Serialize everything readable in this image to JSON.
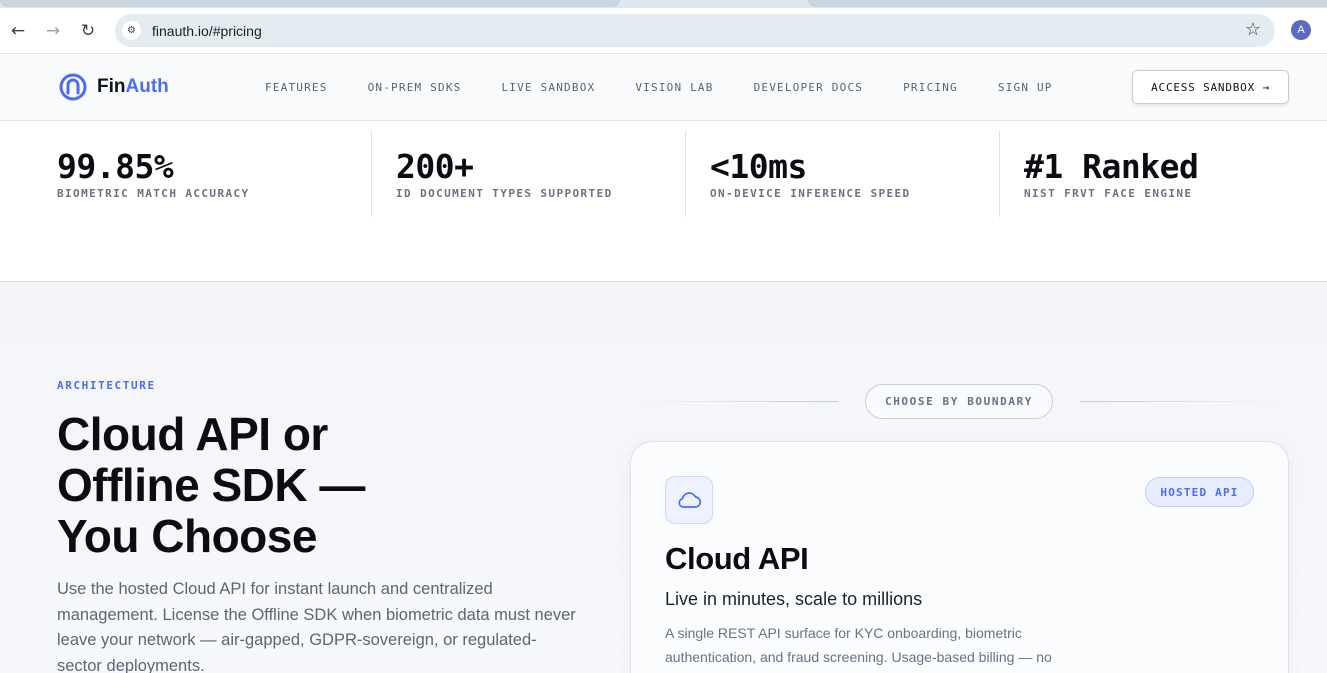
{
  "browser": {
    "url": "finauth.io/#pricing",
    "profile_initial": "A",
    "back_icon": "back-arrow-icon",
    "forward_icon": "forward-arrow-icon",
    "reload_icon": "reload-icon",
    "site_info_icon": "site-settings-icon",
    "bookmark_icon": "star-icon"
  },
  "header": {
    "logo_text_primary": "Fin",
    "logo_text_accent": "Auth",
    "nav": [
      {
        "label": "FEATURES"
      },
      {
        "label": "ON-PREM SDKS"
      },
      {
        "label": "LIVE SANDBOX"
      },
      {
        "label": "VISION LAB"
      },
      {
        "label": "DEVELOPER DOCS"
      },
      {
        "label": "PRICING"
      },
      {
        "label": "SIGN UP"
      }
    ],
    "cta_label": "ACCESS SANDBOX →"
  },
  "stats": [
    {
      "value": "99.85%",
      "label": "BIOMETRIC MATCH ACCURACY"
    },
    {
      "value": "200+",
      "label": "ID DOCUMENT TYPES SUPPORTED"
    },
    {
      "value": "<10ms",
      "label": "ON-DEVICE INFERENCE SPEED"
    },
    {
      "value": "#1 Ranked",
      "label": "NIST FRVT FACE ENGINE"
    }
  ],
  "architecture": {
    "eyebrow": "ARCHITECTURE",
    "headline_line1": "Cloud API or",
    "headline_line2": "Offline SDK —",
    "headline_line3": "You Choose",
    "lead": "Use the hosted Cloud API for instant launch and centralized management. License the Offline SDK when biometric data must never leave your network — air-gapped, GDPR-sovereign, or regulated-sector deployments.",
    "boundary_label": "CHOOSE BY BOUNDARY",
    "card": {
      "icon": "cloud-icon",
      "badge": "HOSTED API",
      "title": "Cloud API",
      "subtitle": "Live in minutes, scale to millions",
      "description": "A single REST API surface for KYC onboarding, biometric authentication, and fraud screening. Usage-based billing — no"
    }
  },
  "colors": {
    "accent": "#4a6cf7",
    "text_primary": "#0b0d12",
    "text_muted": "#6a7282"
  }
}
